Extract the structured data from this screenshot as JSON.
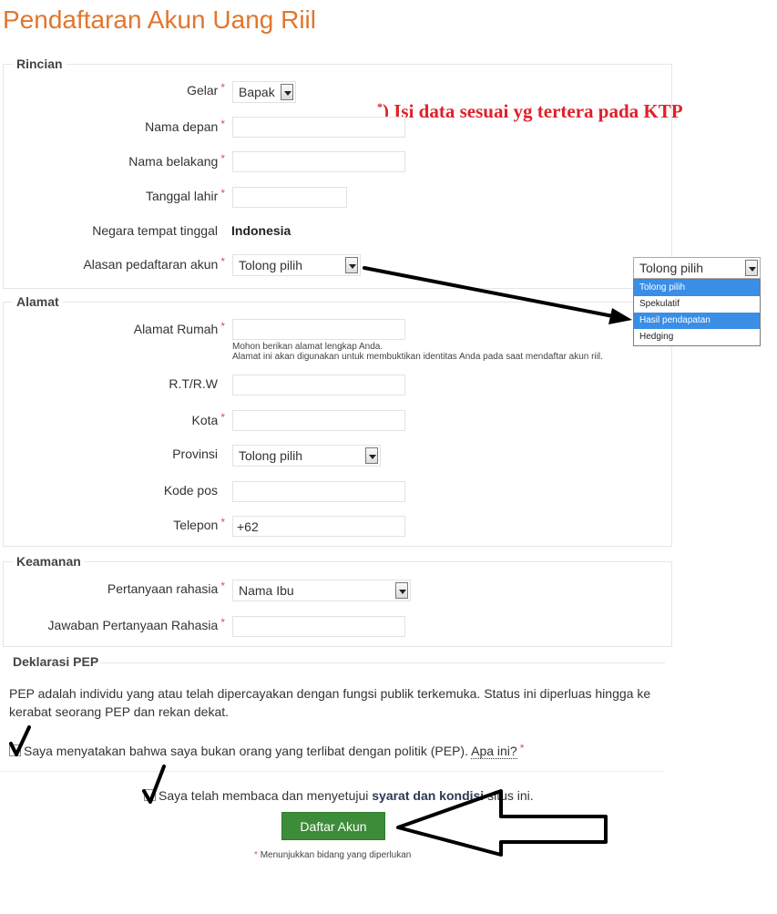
{
  "page": {
    "title": "Pendaftaran Akun Uang Riil"
  },
  "note": {
    "ktp_mark": "*",
    "ktp": ") Isi data sesuai yg tertera pada KTP"
  },
  "required_mark": "*",
  "rincian": {
    "legend": "Rincian",
    "gelar": {
      "label": "Gelar",
      "value": "Bapak"
    },
    "nama_depan": {
      "label": "Nama depan",
      "value": ""
    },
    "nama_belakang": {
      "label": "Nama belakang",
      "value": ""
    },
    "tanggal_lahir": {
      "label": "Tanggal lahir",
      "value": ""
    },
    "negara": {
      "label": "Negara tempat tinggal",
      "value": "Indonesia"
    },
    "alasan": {
      "label": "Alasan pedaftaran akun",
      "value": "Tolong pilih"
    }
  },
  "alasan_popup": {
    "selected": "Tolong pilih",
    "options": [
      "Tolong pilih",
      "Spekulatif",
      "Hasil pendapatan",
      "Hedging"
    ],
    "highlighted": [
      "Tolong pilih",
      "Hasil pendapatan"
    ]
  },
  "alamat": {
    "legend": "Alamat",
    "alamat_rumah": {
      "label": "Alamat Rumah",
      "value": "",
      "help_line1": "Mohon berikan alamat lengkap Anda.",
      "help_line2": "Alamat ini akan digunakan untuk membuktikan identitas Anda pada saat mendaftar akun riil."
    },
    "rt_rw": {
      "label": "R.T/R.W",
      "value": ""
    },
    "kota": {
      "label": "Kota",
      "value": ""
    },
    "provinsi": {
      "label": "Provinsi",
      "value": "Tolong pilih"
    },
    "kode_pos": {
      "label": "Kode pos",
      "value": ""
    },
    "telepon": {
      "label": "Telepon",
      "value": "+62"
    }
  },
  "keamanan": {
    "legend": "Keamanan",
    "pertanyaan": {
      "label": "Pertanyaan rahasia",
      "value": "Nama Ibu"
    },
    "jawaban": {
      "label": "Jawaban Pertanyaan Rahasia",
      "value": ""
    }
  },
  "pep": {
    "legend": "Deklarasi PEP",
    "text": "PEP adalah individu yang atau telah dipercayakan dengan fungsi publik terkemuka. Status ini diperluas hingga ke kerabat seorang PEP dan rekan dekat.",
    "checkbox_label": "Saya menyatakan bahwa saya bukan orang yang terlibat dengan politik (PEP).",
    "link": "Apa ini?",
    "checked": true
  },
  "terms": {
    "prefix": "Saya telah membaca dan menyetujui",
    "link": "syarat dan kondisi",
    "suffix": "situs ini.",
    "checked": true
  },
  "submit": {
    "label": "Daftar Akun"
  },
  "required_note": "Menunjukkan bidang yang diperlukan"
}
